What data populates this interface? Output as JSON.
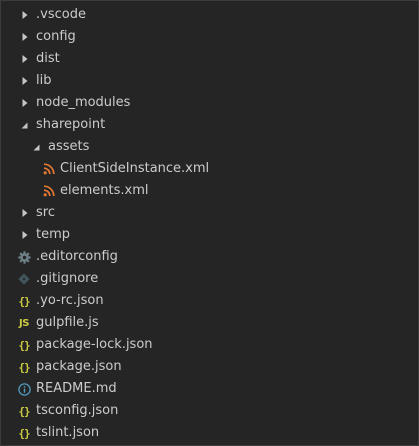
{
  "colors": {
    "background": "#252526",
    "text": "#cccccc",
    "twisty": "#c5c5c5",
    "xml_icon": "#e37933",
    "json_icon": "#cbcb41",
    "js_icon": "#cbcb41",
    "gear_icon": "#6d8086",
    "git_icon": "#41535b",
    "info_icon": "#519aba"
  },
  "tree": {
    "items": [
      {
        "label": ".vscode",
        "kind": "folder",
        "expanded": false
      },
      {
        "label": "config",
        "kind": "folder",
        "expanded": false
      },
      {
        "label": "dist",
        "kind": "folder",
        "expanded": false
      },
      {
        "label": "lib",
        "kind": "folder",
        "expanded": false
      },
      {
        "label": "node_modules",
        "kind": "folder",
        "expanded": false
      },
      {
        "label": "sharepoint",
        "kind": "folder",
        "expanded": true
      },
      {
        "label": "assets",
        "kind": "folder",
        "expanded": true
      },
      {
        "label": "ClientSideInstance.xml",
        "kind": "file",
        "icon": "rss-xml-icon"
      },
      {
        "label": "elements.xml",
        "kind": "file",
        "icon": "rss-xml-icon"
      },
      {
        "label": "src",
        "kind": "folder",
        "expanded": false
      },
      {
        "label": "temp",
        "kind": "folder",
        "expanded": false
      },
      {
        "label": ".editorconfig",
        "kind": "file",
        "icon": "gear-icon"
      },
      {
        "label": ".gitignore",
        "kind": "file",
        "icon": "git-icon"
      },
      {
        "label": ".yo-rc.json",
        "kind": "file",
        "icon": "json-braces-icon"
      },
      {
        "label": "gulpfile.js",
        "kind": "file",
        "icon": "js-icon"
      },
      {
        "label": "package-lock.json",
        "kind": "file",
        "icon": "json-braces-icon"
      },
      {
        "label": "package.json",
        "kind": "file",
        "icon": "json-braces-icon"
      },
      {
        "label": "README.md",
        "kind": "file",
        "icon": "info-icon"
      },
      {
        "label": "tsconfig.json",
        "kind": "file",
        "icon": "json-braces-icon"
      },
      {
        "label": "tslint.json",
        "kind": "file",
        "icon": "json-braces-icon"
      }
    ],
    "json_glyph": "{}",
    "js_glyph": "JS"
  }
}
